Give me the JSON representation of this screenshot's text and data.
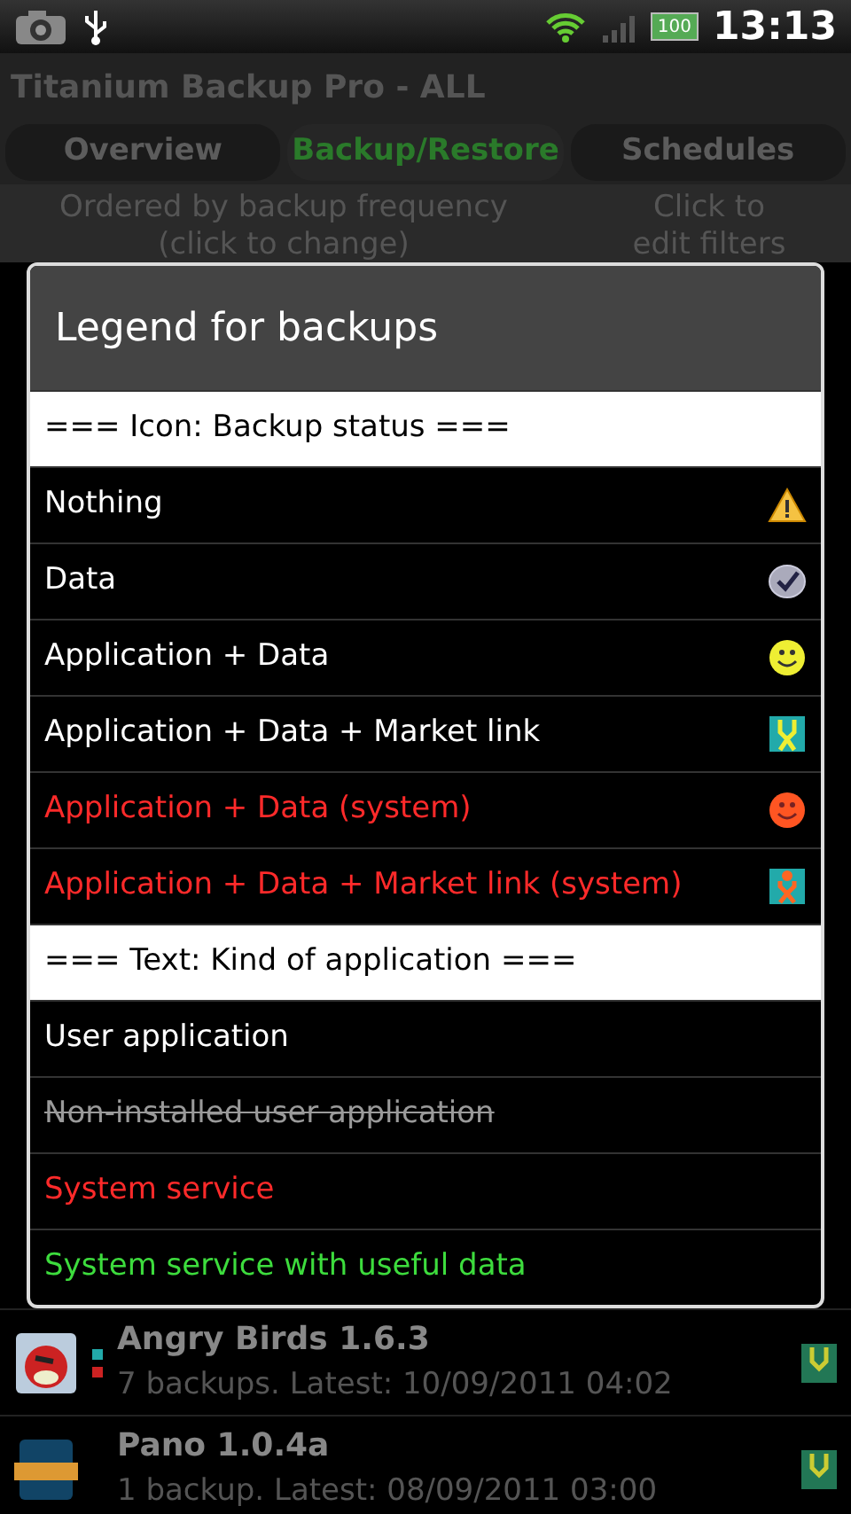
{
  "status_bar": {
    "time": "13:13",
    "battery": "100"
  },
  "app_title": "Titanium Backup Pro - ALL",
  "tabs": [
    {
      "label": "Overview",
      "selected": false
    },
    {
      "label": "Backup/Restore",
      "selected": true
    },
    {
      "label": "Schedules",
      "selected": false
    }
  ],
  "sort_bar": {
    "order": "Ordered by backup frequency",
    "order_hint": "(click to change)",
    "filter": "Click to",
    "filter_hint": "edit filters"
  },
  "dialog": {
    "title": "Legend for backups",
    "rows": [
      {
        "kind": "header",
        "label": "=== Icon: Backup status ==="
      },
      {
        "kind": "warning",
        "label": "Nothing",
        "color": "#ffffff",
        "strikethrough": false
      },
      {
        "kind": "check",
        "label": "Data",
        "color": "#ffffff",
        "strikethrough": false
      },
      {
        "kind": "smiley",
        "label": "Application + Data",
        "color": "#ffffff",
        "strikethrough": false
      },
      {
        "kind": "market",
        "label": "Application + Data + Market link",
        "color": "#ffffff",
        "strikethrough": false
      },
      {
        "kind": "redsmiley",
        "label": "Application + Data (system)",
        "color": "#ff2a2a",
        "strikethrough": false
      },
      {
        "kind": "redmarket",
        "label": "Application + Data + Market link (system)",
        "color": "#ff2a2a",
        "strikethrough": false
      },
      {
        "kind": "header",
        "label": "=== Text: Kind of application ==="
      },
      {
        "kind": "plain",
        "label": "User application",
        "color": "#ffffff",
        "strikethrough": false
      },
      {
        "kind": "plain",
        "label": "Non-installed user application",
        "color": "#9a9a9a",
        "strikethrough": true
      },
      {
        "kind": "plain",
        "label": "System service",
        "color": "#ff2a2a",
        "strikethrough": false
      },
      {
        "kind": "plain",
        "label": "System service with useful data",
        "color": "#3ddc3d",
        "strikethrough": false
      }
    ]
  },
  "apps": [
    {
      "name": "Angry Birds 1.6.3",
      "detail": "7 backups. Latest: 10/09/2011 04:02",
      "markers": true
    },
    {
      "name": "Pano 1.0.4a",
      "detail": "1 backup. Latest: 08/09/2011 03:00",
      "markers": false
    }
  ]
}
